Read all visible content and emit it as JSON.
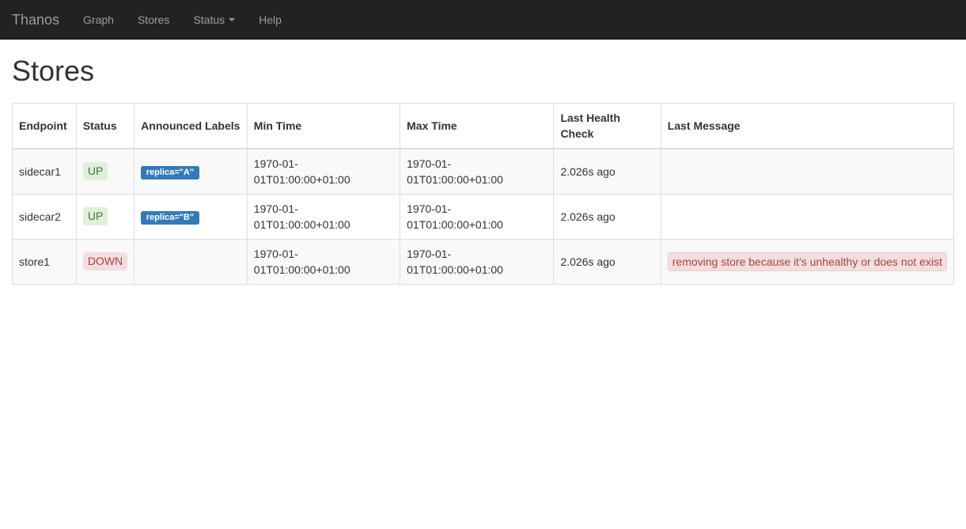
{
  "navbar": {
    "brand": "Thanos",
    "items": [
      {
        "label": "Graph",
        "has_caret": false
      },
      {
        "label": "Stores",
        "has_caret": false
      },
      {
        "label": "Status",
        "has_caret": true
      },
      {
        "label": "Help",
        "has_caret": false
      }
    ]
  },
  "page": {
    "title": "Stores"
  },
  "table": {
    "columns": [
      "Endpoint",
      "Status",
      "Announced Labels",
      "Min Time",
      "Max Time",
      "Last Health Check",
      "Last Message"
    ],
    "rows": [
      {
        "endpoint": "sidecar1",
        "status": "UP",
        "status_state": "up",
        "labels": [
          "replica=\"A\""
        ],
        "min_time": "1970-01-01T01:00:00+01:00",
        "max_time": "1970-01-01T01:00:00+01:00",
        "last_health_check": "2.026s ago",
        "last_message": ""
      },
      {
        "endpoint": "sidecar2",
        "status": "UP",
        "status_state": "up",
        "labels": [
          "replica=\"B\""
        ],
        "min_time": "1970-01-01T01:00:00+01:00",
        "max_time": "1970-01-01T01:00:00+01:00",
        "last_health_check": "2.026s ago",
        "last_message": ""
      },
      {
        "endpoint": "store1",
        "status": "DOWN",
        "status_state": "down",
        "labels": [],
        "min_time": "1970-01-01T01:00:00+01:00",
        "max_time": "1970-01-01T01:00:00+01:00",
        "last_health_check": "2.026s ago",
        "last_message": "removing store because it's unhealthy or does not exist"
      }
    ]
  },
  "colors": {
    "navbar_bg": "#222222",
    "navbar_link": "#9d9d9d",
    "badge_blue": "#337ab7",
    "status_up_bg": "#dff0d8",
    "status_up_text": "#3c763d",
    "status_down_bg": "#f2dede",
    "status_down_text": "#a94442",
    "error_border": "#ebccd1",
    "table_border": "#dddddd",
    "row_stripe": "#f9f9f9"
  }
}
